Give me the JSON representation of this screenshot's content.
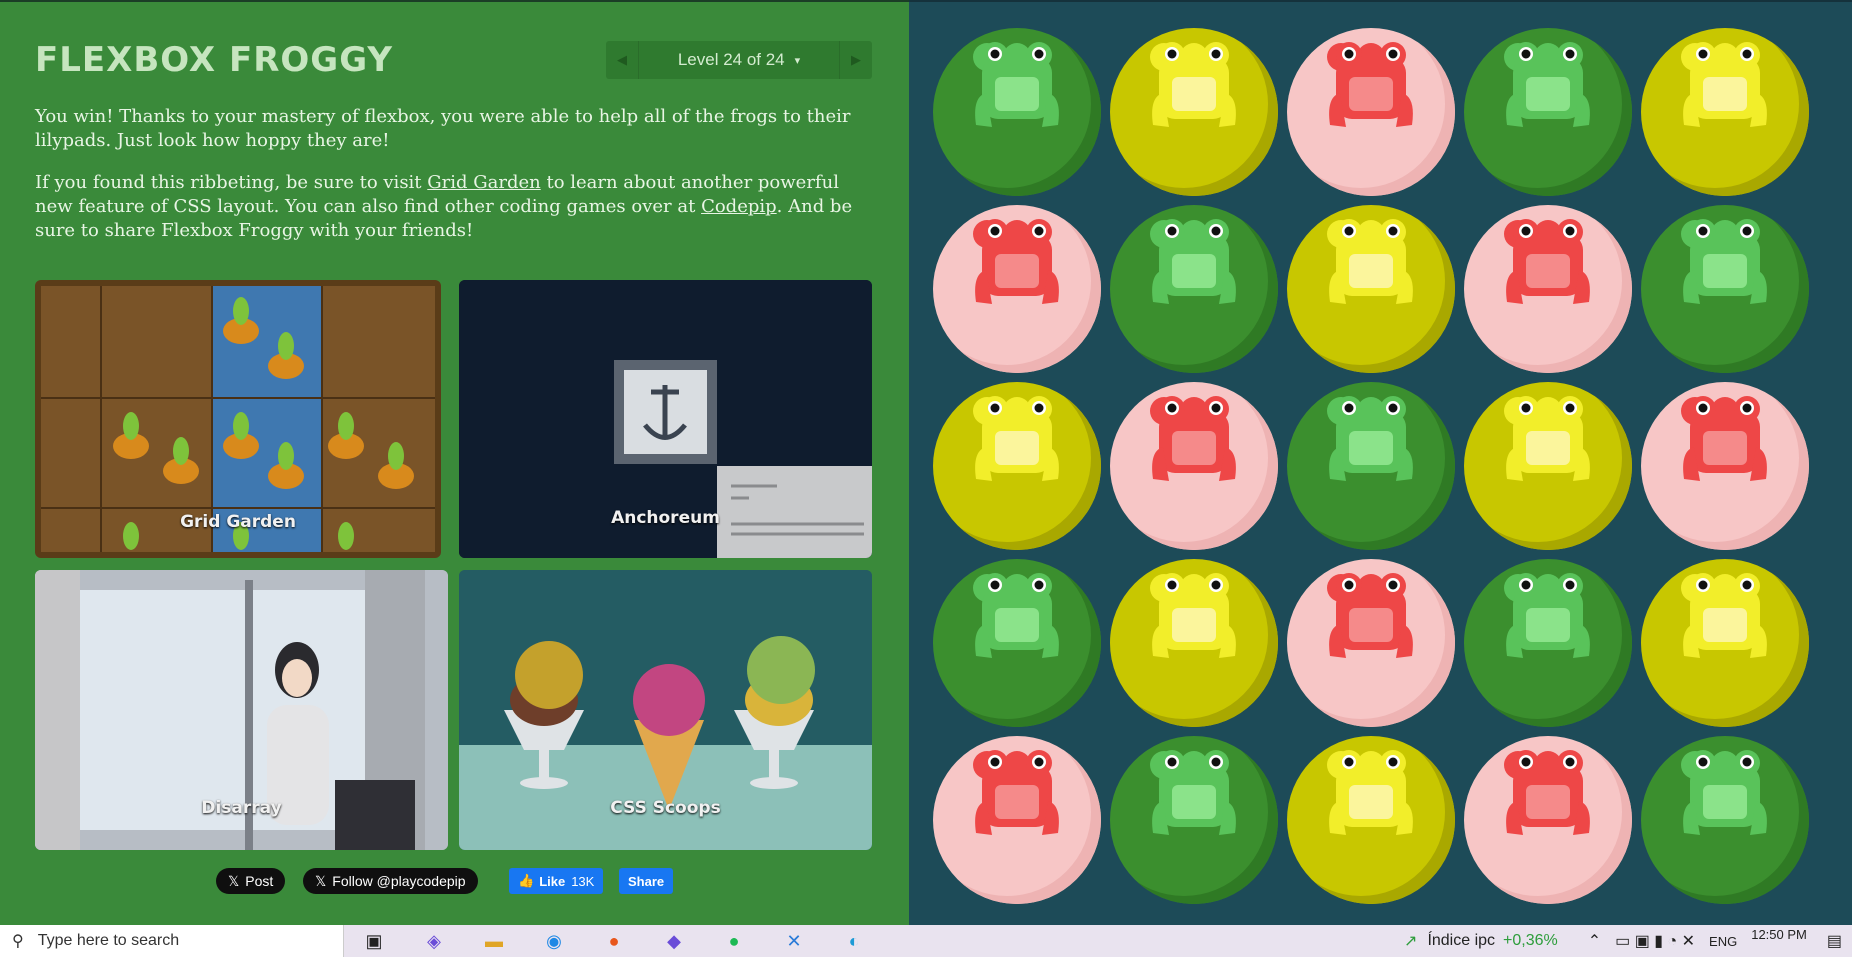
{
  "app": {
    "title": "FLEXBOX FROGGY"
  },
  "level": {
    "label": "Level 24 of 24",
    "caret": "▾",
    "prev": "◀",
    "next": "▶"
  },
  "text": {
    "p1": "You win! Thanks to your mastery of flexbox, you were able to help all of the frogs to their lilypads. Just look how hoppy they are!",
    "p2_a": "If you found this ribbeting, be sure to visit ",
    "p2_link1": "Grid Garden",
    "p2_b": " to learn about another powerful new feature of CSS layout. You can also find other coding games over at ",
    "p2_link2": "Codepip",
    "p2_c": ". And be sure to share Flexbox Froggy with your friends!"
  },
  "games": [
    {
      "label": "Grid Garden"
    },
    {
      "label": "Anchoreum"
    },
    {
      "label": "Disarray"
    },
    {
      "label": "CSS Scoops"
    }
  ],
  "social": {
    "post": "Post",
    "follow": "Follow @playcodepip",
    "like": "Like",
    "like_count": "13K",
    "share": "Share"
  },
  "colors": {
    "green": "#3b8f2e",
    "yellow": "#c8c700",
    "red": "#f4c2c2"
  },
  "board": [
    [
      "green",
      "yellow",
      "red",
      "green",
      "yellow"
    ],
    [
      "red",
      "green",
      "yellow",
      "red",
      "green"
    ],
    [
      "yellow",
      "red",
      "green",
      "yellow",
      "red"
    ],
    [
      "green",
      "yellow",
      "red",
      "green",
      "yellow"
    ],
    [
      "red",
      "green",
      "yellow",
      "red",
      "green"
    ]
  ],
  "taskbar": {
    "search_placeholder": "Type here to search",
    "stock_label": "Índice ipc",
    "stock_change": "+0,36%",
    "lang": "ENG",
    "time": "12:50 PM"
  }
}
